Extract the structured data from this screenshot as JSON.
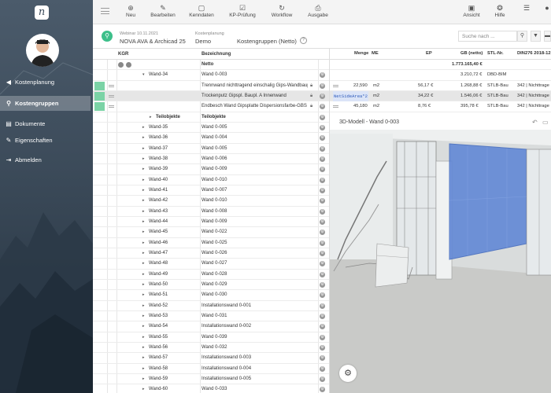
{
  "app": {
    "logo_letter": "n"
  },
  "sidebar": {
    "items": [
      {
        "label": "Kostenplanung",
        "icon": "back-arrow-icon"
      },
      {
        "label": "Kostengruppen",
        "icon": "hierarchy-icon",
        "active": true
      },
      {
        "label": "Dokumente",
        "icon": "document-icon"
      },
      {
        "label": "Eigenschaften",
        "icon": "pencil-icon"
      },
      {
        "label": "Abmelden",
        "icon": "logout-icon"
      }
    ]
  },
  "toolbar": {
    "items": [
      {
        "label": "Neu",
        "icon": "plus-icon"
      },
      {
        "label": "Bearbeiten",
        "icon": "pencil-icon"
      },
      {
        "label": "Kenndaten",
        "icon": "square-icon"
      },
      {
        "label": "KP-Prüfung",
        "icon": "check-icon"
      },
      {
        "label": "Workflow",
        "icon": "refresh-icon"
      },
      {
        "label": "Ausgabe",
        "icon": "print-icon"
      },
      {
        "label": "Ansicht",
        "icon": "view-icon"
      },
      {
        "label": "Hilfe",
        "icon": "help-icon"
      }
    ]
  },
  "context": {
    "date": "Webinar 10.11.2021",
    "project": "NOVA AVA & Archicad 25",
    "plan_caption": "Kostenplanung",
    "plan": "Demo",
    "view": "Kostengruppen (Netto)",
    "search_placeholder": "Suche nach ..."
  },
  "grid": {
    "columns": {
      "kgr": "KGR",
      "bez": "Bezeichnung"
    },
    "netto_label": "Netto",
    "rows": [
      {
        "kgr": "Wand-34",
        "bez": "Wand 0-003",
        "expanded": true
      },
      {
        "kgr": "",
        "bez": "Trennwand nichttragend einschalig Gips-Wandbaupl...",
        "green": true
      },
      {
        "kgr": "",
        "bez": "Trockenputz Gipspl. Baupl. A Innenwand",
        "green": true,
        "sel": true
      },
      {
        "kgr": "",
        "bez": "Endbesch Wand Gipsplatte Dispersionsfarbe-GBS ...",
        "green": true
      },
      {
        "kgr": "Teilobjekte",
        "bez": "Teilobjekte",
        "group": true
      },
      {
        "kgr": "Wand-35",
        "bez": "Wand 0-005"
      },
      {
        "kgr": "Wand-36",
        "bez": "Wand 0-004"
      },
      {
        "kgr": "Wand-37",
        "bez": "Wand 0-005"
      },
      {
        "kgr": "Wand-38",
        "bez": "Wand 0-006"
      },
      {
        "kgr": "Wand-39",
        "bez": "Wand 0-009"
      },
      {
        "kgr": "Wand-40",
        "bez": "Wand 0-010"
      },
      {
        "kgr": "Wand-41",
        "bez": "Wand 0-007"
      },
      {
        "kgr": "Wand-42",
        "bez": "Wand 0-010"
      },
      {
        "kgr": "Wand-43",
        "bez": "Wand 0-008"
      },
      {
        "kgr": "Wand-44",
        "bez": "Wand 0-009"
      },
      {
        "kgr": "Wand-45",
        "bez": "Wand 0-022"
      },
      {
        "kgr": "Wand-46",
        "bez": "Wand 0-025"
      },
      {
        "kgr": "Wand-47",
        "bez": "Wand 0-026"
      },
      {
        "kgr": "Wand-48",
        "bez": "Wand 0-027"
      },
      {
        "kgr": "Wand-49",
        "bez": "Wand 0-028"
      },
      {
        "kgr": "Wand-50",
        "bez": "Wand 0-029"
      },
      {
        "kgr": "Wand-51",
        "bez": "Wand 0-030"
      },
      {
        "kgr": "Wand-52",
        "bez": "Installationswand 0-001"
      },
      {
        "kgr": "Wand-53",
        "bez": "Wand 0-031"
      },
      {
        "kgr": "Wand-54",
        "bez": "Installationswand 0-002"
      },
      {
        "kgr": "Wand-55",
        "bez": "Wand 0-039"
      },
      {
        "kgr": "Wand-56",
        "bez": "Wand 0-032"
      },
      {
        "kgr": "Wand-57",
        "bez": "Installationswand 0-003"
      },
      {
        "kgr": "Wand-58",
        "bez": "Installationswand 0-004"
      },
      {
        "kgr": "Wand-59",
        "bez": "Installationswand 0-005"
      },
      {
        "kgr": "Wand-60",
        "bez": "Wand 0-033"
      }
    ]
  },
  "right": {
    "columns": {
      "menge": "Menge",
      "me": "ME",
      "ep": "EP",
      "gb": "GB (netto)",
      "stl": "STL-Nr.",
      "din": "DIN276 2018-12"
    },
    "total": "1.773.165,40 €",
    "rows": [
      {
        "menge": "",
        "me": "",
        "ep": "",
        "gb": "3.210,72 €",
        "stl": "DBD-BIM",
        "din": ""
      },
      {
        "menge": "22,590",
        "me": "m2",
        "ep": "56,17 €",
        "gb": "1.268,88 €",
        "stl": "STLB-Bau",
        "din": "342 | Nichttrage"
      },
      {
        "menge": "NetSideArea*2",
        "me": "m2",
        "ep": "34,22 €",
        "gb": "1.546,06 €",
        "stl": "STLB-Bau",
        "din": "342 | Nichttrage",
        "tag": true
      },
      {
        "menge": "45,180",
        "me": "m2",
        "ep": "8,76 €",
        "gb": "395,78 €",
        "stl": "STLB-Bau",
        "din": "342 | Nichttrage"
      }
    ],
    "model_title": "3D-Modell - Wand 0-003"
  }
}
